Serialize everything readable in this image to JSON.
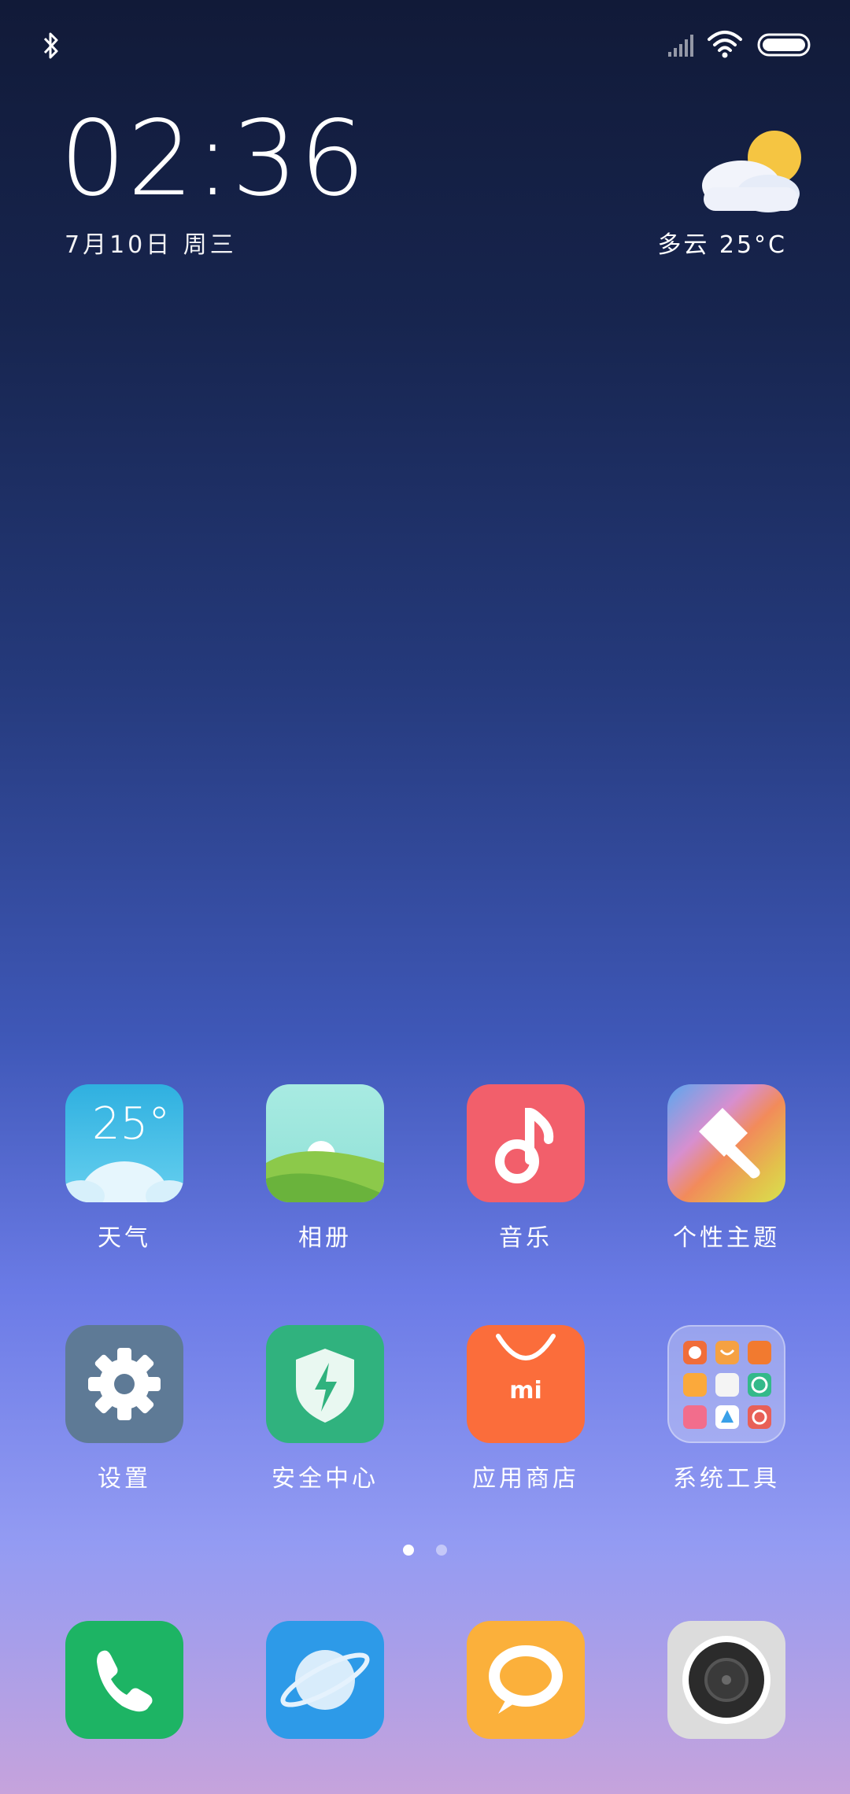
{
  "status_bar": {
    "left_icons": [
      "bluetooth-icon"
    ],
    "right_icons": [
      "signal-icon",
      "wifi-icon",
      "battery-icon"
    ]
  },
  "clock": {
    "time": "02:36",
    "date": "7月10日 周三"
  },
  "weather": {
    "icon": "partly-cloudy-icon",
    "text": "多云 25°C"
  },
  "apps": [
    {
      "label": "天气",
      "icon": "weather-icon",
      "tile_text": "25°",
      "color": "#38b6e6"
    },
    {
      "label": "相册",
      "icon": "gallery-icon",
      "color": "#9ee6dc"
    },
    {
      "label": "音乐",
      "icon": "music-icon",
      "color": "#f25f6b"
    },
    {
      "label": "个性主题",
      "icon": "themes-icon",
      "color": "#e9b34d"
    },
    {
      "label": "设置",
      "icon": "settings-gear-icon",
      "color": "#5e7a96"
    },
    {
      "label": "安全中心",
      "icon": "security-shield-icon",
      "color": "#30b27e"
    },
    {
      "label": "应用商店",
      "icon": "app-store-icon",
      "tile_text": "mi",
      "color": "#fb6d3b"
    },
    {
      "label": "系统工具",
      "icon": "folder-icon",
      "color": "#dfe3f5"
    }
  ],
  "page_indicator": {
    "pages": 2,
    "current": 1
  },
  "dock": [
    {
      "icon": "phone-icon",
      "color": "#1db464"
    },
    {
      "icon": "browser-icon",
      "color": "#2d9ae8"
    },
    {
      "icon": "messages-icon",
      "color": "#fbb03b"
    },
    {
      "icon": "camera-icon",
      "color": "#dcdcdc"
    }
  ]
}
